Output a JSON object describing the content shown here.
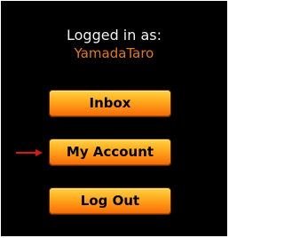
{
  "session": {
    "logged_in_label": "Logged in as:",
    "username": "YamadaTaro"
  },
  "menu": {
    "buttons": [
      {
        "label": "Inbox"
      },
      {
        "label": "My Account",
        "current": true
      },
      {
        "label": "Log Out"
      }
    ],
    "current_indicator_icon": "right-arrow-icon"
  },
  "colors": {
    "background": "#000000",
    "username": "#e07a1e",
    "button_orange": "#ff8a12",
    "indicator_red": "#d81818"
  }
}
